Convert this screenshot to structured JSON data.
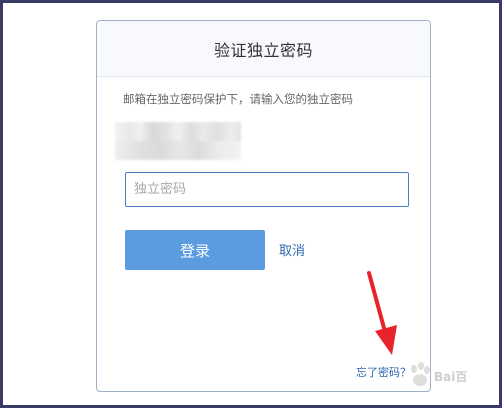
{
  "dialog": {
    "title": "验证独立密码",
    "prompt": "邮箱在独立密码保护下，请输入您的独立密码",
    "password_placeholder": "独立密码",
    "password_value": "",
    "login_label": "登录",
    "cancel_label": "取消",
    "forgot_label": "忘了密码？"
  },
  "annotation": {
    "arrow_color": "#e8232a"
  },
  "watermark": {
    "text": "Bai百"
  },
  "colors": {
    "login_button": "#5b9be0",
    "link": "#2d67b0",
    "input_border": "#4a7fc1"
  }
}
